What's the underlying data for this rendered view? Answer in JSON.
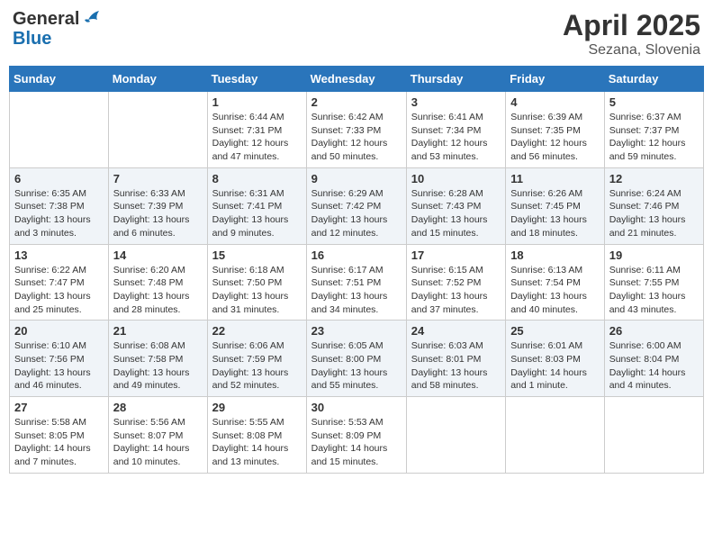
{
  "header": {
    "logo_general": "General",
    "logo_blue": "Blue",
    "month_year": "April 2025",
    "location": "Sezana, Slovenia"
  },
  "days_of_week": [
    "Sunday",
    "Monday",
    "Tuesday",
    "Wednesday",
    "Thursday",
    "Friday",
    "Saturday"
  ],
  "weeks": [
    [
      {
        "day": "",
        "sunrise": "",
        "sunset": "",
        "daylight": ""
      },
      {
        "day": "",
        "sunrise": "",
        "sunset": "",
        "daylight": ""
      },
      {
        "day": "1",
        "sunrise": "Sunrise: 6:44 AM",
        "sunset": "Sunset: 7:31 PM",
        "daylight": "Daylight: 12 hours and 47 minutes."
      },
      {
        "day": "2",
        "sunrise": "Sunrise: 6:42 AM",
        "sunset": "Sunset: 7:33 PM",
        "daylight": "Daylight: 12 hours and 50 minutes."
      },
      {
        "day": "3",
        "sunrise": "Sunrise: 6:41 AM",
        "sunset": "Sunset: 7:34 PM",
        "daylight": "Daylight: 12 hours and 53 minutes."
      },
      {
        "day": "4",
        "sunrise": "Sunrise: 6:39 AM",
        "sunset": "Sunset: 7:35 PM",
        "daylight": "Daylight: 12 hours and 56 minutes."
      },
      {
        "day": "5",
        "sunrise": "Sunrise: 6:37 AM",
        "sunset": "Sunset: 7:37 PM",
        "daylight": "Daylight: 12 hours and 59 minutes."
      }
    ],
    [
      {
        "day": "6",
        "sunrise": "Sunrise: 6:35 AM",
        "sunset": "Sunset: 7:38 PM",
        "daylight": "Daylight: 13 hours and 3 minutes."
      },
      {
        "day": "7",
        "sunrise": "Sunrise: 6:33 AM",
        "sunset": "Sunset: 7:39 PM",
        "daylight": "Daylight: 13 hours and 6 minutes."
      },
      {
        "day": "8",
        "sunrise": "Sunrise: 6:31 AM",
        "sunset": "Sunset: 7:41 PM",
        "daylight": "Daylight: 13 hours and 9 minutes."
      },
      {
        "day": "9",
        "sunrise": "Sunrise: 6:29 AM",
        "sunset": "Sunset: 7:42 PM",
        "daylight": "Daylight: 13 hours and 12 minutes."
      },
      {
        "day": "10",
        "sunrise": "Sunrise: 6:28 AM",
        "sunset": "Sunset: 7:43 PM",
        "daylight": "Daylight: 13 hours and 15 minutes."
      },
      {
        "day": "11",
        "sunrise": "Sunrise: 6:26 AM",
        "sunset": "Sunset: 7:45 PM",
        "daylight": "Daylight: 13 hours and 18 minutes."
      },
      {
        "day": "12",
        "sunrise": "Sunrise: 6:24 AM",
        "sunset": "Sunset: 7:46 PM",
        "daylight": "Daylight: 13 hours and 21 minutes."
      }
    ],
    [
      {
        "day": "13",
        "sunrise": "Sunrise: 6:22 AM",
        "sunset": "Sunset: 7:47 PM",
        "daylight": "Daylight: 13 hours and 25 minutes."
      },
      {
        "day": "14",
        "sunrise": "Sunrise: 6:20 AM",
        "sunset": "Sunset: 7:48 PM",
        "daylight": "Daylight: 13 hours and 28 minutes."
      },
      {
        "day": "15",
        "sunrise": "Sunrise: 6:18 AM",
        "sunset": "Sunset: 7:50 PM",
        "daylight": "Daylight: 13 hours and 31 minutes."
      },
      {
        "day": "16",
        "sunrise": "Sunrise: 6:17 AM",
        "sunset": "Sunset: 7:51 PM",
        "daylight": "Daylight: 13 hours and 34 minutes."
      },
      {
        "day": "17",
        "sunrise": "Sunrise: 6:15 AM",
        "sunset": "Sunset: 7:52 PM",
        "daylight": "Daylight: 13 hours and 37 minutes."
      },
      {
        "day": "18",
        "sunrise": "Sunrise: 6:13 AM",
        "sunset": "Sunset: 7:54 PM",
        "daylight": "Daylight: 13 hours and 40 minutes."
      },
      {
        "day": "19",
        "sunrise": "Sunrise: 6:11 AM",
        "sunset": "Sunset: 7:55 PM",
        "daylight": "Daylight: 13 hours and 43 minutes."
      }
    ],
    [
      {
        "day": "20",
        "sunrise": "Sunrise: 6:10 AM",
        "sunset": "Sunset: 7:56 PM",
        "daylight": "Daylight: 13 hours and 46 minutes."
      },
      {
        "day": "21",
        "sunrise": "Sunrise: 6:08 AM",
        "sunset": "Sunset: 7:58 PM",
        "daylight": "Daylight: 13 hours and 49 minutes."
      },
      {
        "day": "22",
        "sunrise": "Sunrise: 6:06 AM",
        "sunset": "Sunset: 7:59 PM",
        "daylight": "Daylight: 13 hours and 52 minutes."
      },
      {
        "day": "23",
        "sunrise": "Sunrise: 6:05 AM",
        "sunset": "Sunset: 8:00 PM",
        "daylight": "Daylight: 13 hours and 55 minutes."
      },
      {
        "day": "24",
        "sunrise": "Sunrise: 6:03 AM",
        "sunset": "Sunset: 8:01 PM",
        "daylight": "Daylight: 13 hours and 58 minutes."
      },
      {
        "day": "25",
        "sunrise": "Sunrise: 6:01 AM",
        "sunset": "Sunset: 8:03 PM",
        "daylight": "Daylight: 14 hours and 1 minute."
      },
      {
        "day": "26",
        "sunrise": "Sunrise: 6:00 AM",
        "sunset": "Sunset: 8:04 PM",
        "daylight": "Daylight: 14 hours and 4 minutes."
      }
    ],
    [
      {
        "day": "27",
        "sunrise": "Sunrise: 5:58 AM",
        "sunset": "Sunset: 8:05 PM",
        "daylight": "Daylight: 14 hours and 7 minutes."
      },
      {
        "day": "28",
        "sunrise": "Sunrise: 5:56 AM",
        "sunset": "Sunset: 8:07 PM",
        "daylight": "Daylight: 14 hours and 10 minutes."
      },
      {
        "day": "29",
        "sunrise": "Sunrise: 5:55 AM",
        "sunset": "Sunset: 8:08 PM",
        "daylight": "Daylight: 14 hours and 13 minutes."
      },
      {
        "day": "30",
        "sunrise": "Sunrise: 5:53 AM",
        "sunset": "Sunset: 8:09 PM",
        "daylight": "Daylight: 14 hours and 15 minutes."
      },
      {
        "day": "",
        "sunrise": "",
        "sunset": "",
        "daylight": ""
      },
      {
        "day": "",
        "sunrise": "",
        "sunset": "",
        "daylight": ""
      },
      {
        "day": "",
        "sunrise": "",
        "sunset": "",
        "daylight": ""
      }
    ]
  ]
}
